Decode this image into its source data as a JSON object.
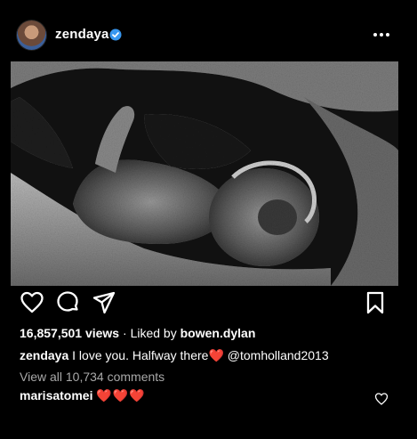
{
  "post": {
    "username": "zendaya",
    "views": "16,857,501 views",
    "separator": "·",
    "liked_by_prefix": "Liked by",
    "liked_by_user": "bowen.dylan",
    "caption_user": "zendaya",
    "caption_text": "I love you. Halfway there",
    "caption_heart": "❤️",
    "caption_mention": "@tomholland2013",
    "view_all_comments": "View all 10,734 comments",
    "comment_user": "marisatomei",
    "comment_text": "❤️❤️❤️"
  },
  "icons": {
    "verified": "verified-badge-icon",
    "more": "more-options-icon",
    "like": "heart-icon",
    "comment": "comment-icon",
    "share": "send-icon",
    "save": "bookmark-icon"
  },
  "colors": {
    "background": "#000000",
    "verified": "#3897f0",
    "heart": "#e0202a",
    "muted_text": "#a8a8a8"
  }
}
